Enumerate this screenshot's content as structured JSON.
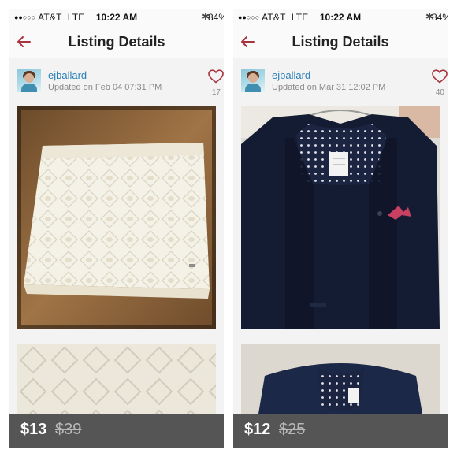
{
  "panels": [
    {
      "status_bar": {
        "carrier": "AT&T",
        "network": "LTE",
        "time": "10:22 AM",
        "battery": "84%"
      },
      "nav": {
        "title": "Listing Details"
      },
      "seller": {
        "username": "ejballard",
        "updated": "Updated on Feb 04 07:31 PM"
      },
      "likes": "17",
      "price": {
        "current": "$13",
        "original": "$39"
      }
    },
    {
      "status_bar": {
        "carrier": "AT&T",
        "network": "LTE",
        "time": "10:22 AM",
        "battery": "84%"
      },
      "nav": {
        "title": "Listing Details"
      },
      "seller": {
        "username": "ejballard",
        "updated": "Updated on Mar 31 12:02 PM"
      },
      "likes": "40",
      "price": {
        "current": "$12",
        "original": "$25"
      }
    }
  ],
  "colors": {
    "accent": "#a8323e",
    "link": "#2a7fb8",
    "price_bar": "#555555"
  },
  "icons": {
    "back": "back-arrow-icon",
    "like": "heart-icon",
    "bluetooth": "bluetooth-icon"
  }
}
